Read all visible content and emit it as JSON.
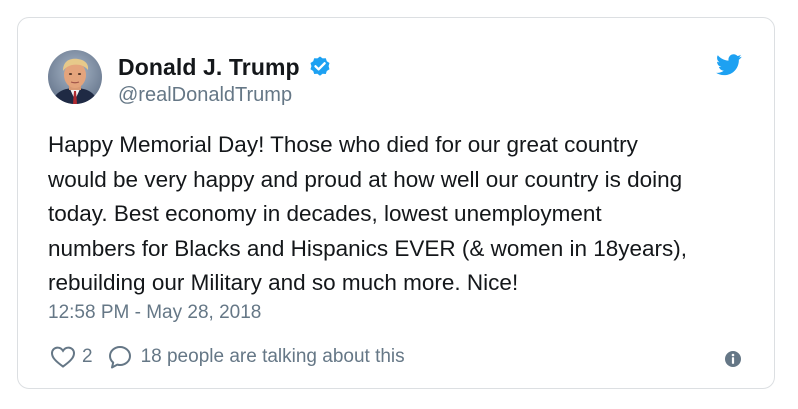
{
  "tweet": {
    "author": {
      "display_name": "Donald J. Trump",
      "handle": "@realDonaldTrump",
      "verified": true,
      "avatar_icon": "profile-photo",
      "verified_icon": "verified-badge-icon"
    },
    "text": "Happy Memorial Day! Those who died for our great country\nwould be very happy and proud at how well our country is doing\ntoday. Best economy in decades, lowest unemployment\nnumbers for Blacks and Hispanics EVER (& women in 18years),\nrebuilding our Military and so much more. Nice!",
    "timestamp": "12:58 PM - May 28, 2018",
    "actions": {
      "like_count": "2",
      "talking": "18 people are talking about this"
    },
    "icons": {
      "brand": "twitter-bird-icon",
      "like": "heart-icon",
      "reply": "reply-bubble-icon",
      "info": "info-icon"
    }
  },
  "colors": {
    "brand": "#1da1f2",
    "text_primary": "#14171a",
    "text_secondary": "#657786",
    "border": "#dcdfe2"
  }
}
